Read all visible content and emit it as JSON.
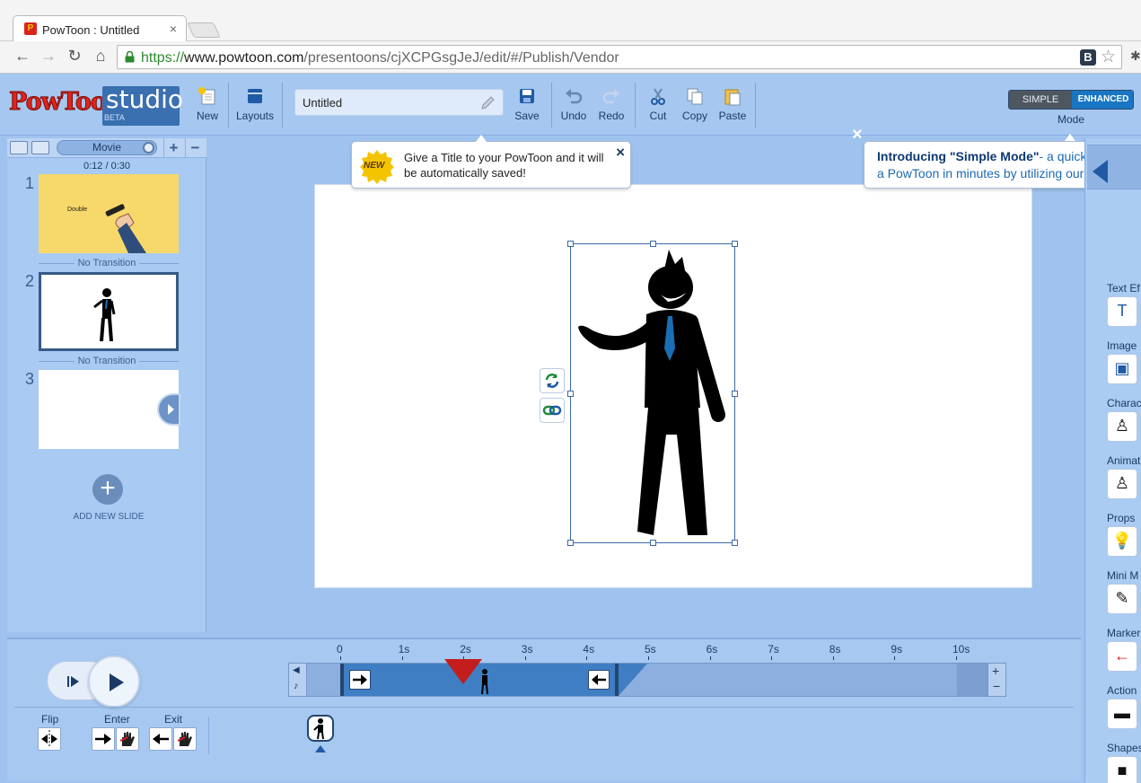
{
  "browser": {
    "tab_title": "PowToon : Untitled",
    "tab_close": "×",
    "url_scheme": "https://",
    "url_host": "www.powtoon.com",
    "url_path": "/presentoons/cjXCPGsgJeJ/edit/#/Publish/Vendor",
    "ext_badge": "B"
  },
  "logo": {
    "pow": "PowToon",
    "studio": "studio",
    "beta": "BETA"
  },
  "toolbar": {
    "new": "New",
    "layouts": "Layouts",
    "title_value": "Untitled",
    "save": "Save",
    "undo": "Undo",
    "redo": "Redo",
    "cut": "Cut",
    "copy": "Copy",
    "paste": "Paste",
    "mode_simple": "SIMPLE",
    "mode_enhanced": "ENHANCED",
    "mode_label": "Mode"
  },
  "tips": {
    "title_tip_badge": "NEW",
    "title_tip_text": "Give a Title to your PowToon and it will be automatically saved!",
    "close": "×",
    "simple_mode_bold": "Introducing \"Simple Mode\"",
    "simple_mode_rest": "- a quick an",
    "simple_mode_line2": "a PowToon in minutes by utilizing our ready"
  },
  "slides_panel": {
    "movie_label": "Movie",
    "plus": "+",
    "minus": "−",
    "timecode": "0:12 / 0:30",
    "slides": [
      {
        "num": "1",
        "thumb_text": "Double",
        "transition": "No Transition"
      },
      {
        "num": "2",
        "transition": "No Transition"
      },
      {
        "num": "3"
      }
    ],
    "add_slide": "ADD NEW SLIDE"
  },
  "right_panel": {
    "items": [
      "Text Ef",
      "Image",
      "Charac",
      "Animat",
      "Props",
      "Mini M",
      "Marker",
      "Action",
      "Shapes"
    ]
  },
  "timeline": {
    "ticks": [
      "0",
      "1s",
      "2s",
      "3s",
      "4s",
      "5s",
      "6s",
      "7s",
      "8s",
      "9s",
      "10s"
    ],
    "plus": "+",
    "minus": "−",
    "flip": "Flip",
    "enter": "Enter",
    "exit": "Exit"
  },
  "colors": {
    "accent": "#1976c4",
    "playhead": "#c41d1d",
    "clip": "#3f7ec3"
  }
}
